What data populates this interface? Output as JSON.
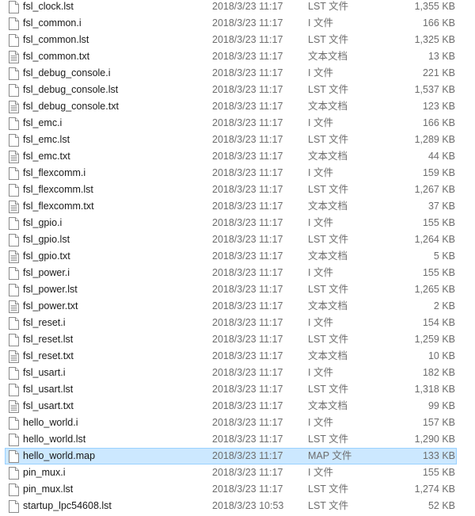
{
  "files": [
    {
      "name": "fsl_clock.lst",
      "date": "2018/3/23 11:17",
      "type": "LST 文件",
      "size": "1,355 KB",
      "icon": "file-icon"
    },
    {
      "name": "fsl_common.i",
      "date": "2018/3/23 11:17",
      "type": "I 文件",
      "size": "166 KB",
      "icon": "file-icon"
    },
    {
      "name": "fsl_common.lst",
      "date": "2018/3/23 11:17",
      "type": "LST 文件",
      "size": "1,325 KB",
      "icon": "file-icon"
    },
    {
      "name": "fsl_common.txt",
      "date": "2018/3/23 11:17",
      "type": "文本文档",
      "size": "13 KB",
      "icon": "text-file-icon"
    },
    {
      "name": "fsl_debug_console.i",
      "date": "2018/3/23 11:17",
      "type": "I 文件",
      "size": "221 KB",
      "icon": "file-icon"
    },
    {
      "name": "fsl_debug_console.lst",
      "date": "2018/3/23 11:17",
      "type": "LST 文件",
      "size": "1,537 KB",
      "icon": "file-icon"
    },
    {
      "name": "fsl_debug_console.txt",
      "date": "2018/3/23 11:17",
      "type": "文本文档",
      "size": "123 KB",
      "icon": "text-file-icon"
    },
    {
      "name": "fsl_emc.i",
      "date": "2018/3/23 11:17",
      "type": "I 文件",
      "size": "166 KB",
      "icon": "file-icon"
    },
    {
      "name": "fsl_emc.lst",
      "date": "2018/3/23 11:17",
      "type": "LST 文件",
      "size": "1,289 KB",
      "icon": "file-icon"
    },
    {
      "name": "fsl_emc.txt",
      "date": "2018/3/23 11:17",
      "type": "文本文档",
      "size": "44 KB",
      "icon": "text-file-icon"
    },
    {
      "name": "fsl_flexcomm.i",
      "date": "2018/3/23 11:17",
      "type": "I 文件",
      "size": "159 KB",
      "icon": "file-icon"
    },
    {
      "name": "fsl_flexcomm.lst",
      "date": "2018/3/23 11:17",
      "type": "LST 文件",
      "size": "1,267 KB",
      "icon": "file-icon"
    },
    {
      "name": "fsl_flexcomm.txt",
      "date": "2018/3/23 11:17",
      "type": "文本文档",
      "size": "37 KB",
      "icon": "text-file-icon"
    },
    {
      "name": "fsl_gpio.i",
      "date": "2018/3/23 11:17",
      "type": "I 文件",
      "size": "155 KB",
      "icon": "file-icon"
    },
    {
      "name": "fsl_gpio.lst",
      "date": "2018/3/23 11:17",
      "type": "LST 文件",
      "size": "1,264 KB",
      "icon": "file-icon"
    },
    {
      "name": "fsl_gpio.txt",
      "date": "2018/3/23 11:17",
      "type": "文本文档",
      "size": "5 KB",
      "icon": "text-file-icon"
    },
    {
      "name": "fsl_power.i",
      "date": "2018/3/23 11:17",
      "type": "I 文件",
      "size": "155 KB",
      "icon": "file-icon"
    },
    {
      "name": "fsl_power.lst",
      "date": "2018/3/23 11:17",
      "type": "LST 文件",
      "size": "1,265 KB",
      "icon": "file-icon"
    },
    {
      "name": "fsl_power.txt",
      "date": "2018/3/23 11:17",
      "type": "文本文档",
      "size": "2 KB",
      "icon": "text-file-icon"
    },
    {
      "name": "fsl_reset.i",
      "date": "2018/3/23 11:17",
      "type": "I 文件",
      "size": "154 KB",
      "icon": "file-icon"
    },
    {
      "name": "fsl_reset.lst",
      "date": "2018/3/23 11:17",
      "type": "LST 文件",
      "size": "1,259 KB",
      "icon": "file-icon"
    },
    {
      "name": "fsl_reset.txt",
      "date": "2018/3/23 11:17",
      "type": "文本文档",
      "size": "10 KB",
      "icon": "text-file-icon"
    },
    {
      "name": "fsl_usart.i",
      "date": "2018/3/23 11:17",
      "type": "I 文件",
      "size": "182 KB",
      "icon": "file-icon"
    },
    {
      "name": "fsl_usart.lst",
      "date": "2018/3/23 11:17",
      "type": "LST 文件",
      "size": "1,318 KB",
      "icon": "file-icon"
    },
    {
      "name": "fsl_usart.txt",
      "date": "2018/3/23 11:17",
      "type": "文本文档",
      "size": "99 KB",
      "icon": "text-file-icon"
    },
    {
      "name": "hello_world.i",
      "date": "2018/3/23 11:17",
      "type": "I 文件",
      "size": "157 KB",
      "icon": "file-icon"
    },
    {
      "name": "hello_world.lst",
      "date": "2018/3/23 11:17",
      "type": "LST 文件",
      "size": "1,290 KB",
      "icon": "file-icon"
    },
    {
      "name": "hello_world.map",
      "date": "2018/3/23 11:17",
      "type": "MAP 文件",
      "size": "133 KB",
      "icon": "file-icon",
      "selected": true
    },
    {
      "name": "pin_mux.i",
      "date": "2018/3/23 11:17",
      "type": "I 文件",
      "size": "155 KB",
      "icon": "file-icon"
    },
    {
      "name": "pin_mux.lst",
      "date": "2018/3/23 11:17",
      "type": "LST 文件",
      "size": "1,274 KB",
      "icon": "file-icon"
    },
    {
      "name": "startup_lpc54608.lst",
      "date": "2018/3/23 10:53",
      "type": "LST 文件",
      "size": "52 KB",
      "icon": "file-icon"
    }
  ]
}
